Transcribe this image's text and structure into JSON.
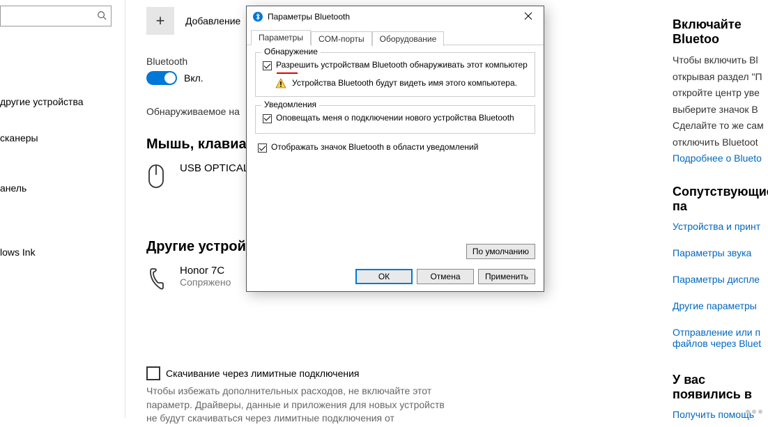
{
  "sidebar": {
    "search_placeholder": "",
    "items": [
      {
        "label": "другие устройства"
      },
      {
        "label": "сканеры"
      },
      {
        "label": "анель"
      },
      {
        "label": "lows Ink"
      }
    ]
  },
  "main": {
    "add_device_label": "Добавление",
    "bluetooth_label": "Bluetooth",
    "toggle_state_label": "Вкл.",
    "discoverable_label": "Обнаруживаемое на",
    "section_mouse": "Мышь, клавиату",
    "device_mouse": {
      "name": "USB OPTICAL",
      "status": ""
    },
    "section_other": "Другие устройс",
    "device_phone": {
      "name": "Honor 7C",
      "status": "Сопряжено"
    },
    "metered_checkbox_label": "Скачивание через лимитные подключения",
    "metered_help": "Чтобы избежать дополнительных расходов, не включайте этот параметр. Драйверы, данные и приложения для новых устройств не будут скачиваться через лимитные подключения от"
  },
  "right": {
    "turn_on_title": "Включайте Bluetoo",
    "turn_on_body_lines": [
      "Чтобы включить Bl",
      "открывая раздел \"П",
      "откройте центр уве",
      "выберите значок B",
      "Сделайте то же сам",
      "отключить Bluetoot"
    ],
    "learn_more": "Подробнее о Blueto",
    "related_title": "Сопутствующие па",
    "links": [
      "Устройства и принт",
      "Параметры звука",
      "Параметры диспле",
      "Другие параметры"
    ],
    "send_files": "Отправление или п\nфайлов через Bluet",
    "questions_title": "У вас появились в",
    "get_help_link": "Получить помощь"
  },
  "dialog": {
    "title": "Параметры Bluetooth",
    "tabs": [
      "Параметры",
      "COM-порты",
      "Оборудование"
    ],
    "group_discovery": {
      "title": "Обнаружение",
      "allow_label": "Разрешить устройствам Bluetooth обнаруживать этот компьютер",
      "warn_text": "Устройства Bluetooth будут видеть имя этого компьютера."
    },
    "group_notifications": {
      "title": "Уведомления",
      "notify_label": "Оповещать меня о подключении нового устройства Bluetooth"
    },
    "show_icon_label": "Отображать значок Bluetooth в области уведомлений",
    "defaults_btn": "По умолчанию",
    "ok_btn": "ОК",
    "cancel_btn": "Отмена",
    "apply_btn": "Применить"
  }
}
